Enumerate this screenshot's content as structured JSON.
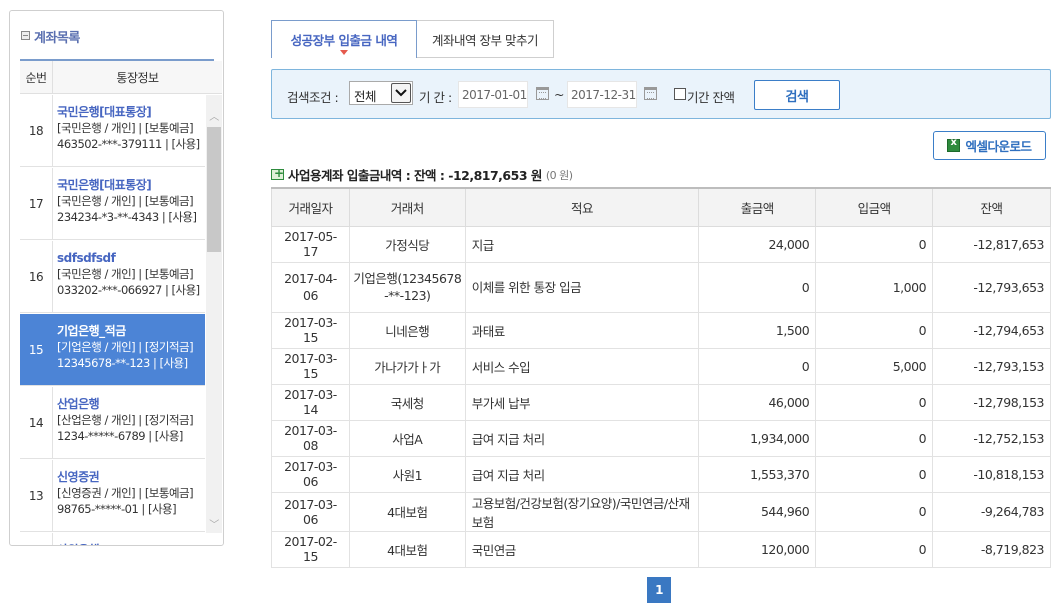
{
  "sidebar": {
    "title": "계좌목록",
    "col_no": "순번",
    "col_info": "통장정보",
    "accounts": [
      {
        "no": "18",
        "name": "국민은행[대표통장]",
        "line1": "[국민은행 / 개인] | [보통예금]",
        "line2": "463502-***-379111 | [사용]",
        "selected": false
      },
      {
        "no": "17",
        "name": "국민은행[대표통장]",
        "line1": "[국민은행 / 개인] | [보통예금]",
        "line2": "234234-*3-**-4343 | [사용]",
        "selected": false
      },
      {
        "no": "16",
        "name": "sdfsdfsdf",
        "line1": "[국민은행 / 개인] | [보통예금]",
        "line2": "033202-***-066927 | [사용]",
        "selected": false
      },
      {
        "no": "15",
        "name": "기업은행_적금",
        "line1": "[기업은행 / 개인] | [정기적금]",
        "line2": "12345678-**-123 | [사용]",
        "selected": true
      },
      {
        "no": "14",
        "name": "산업은행",
        "line1": "[산업은행 / 개인] | [정기적금]",
        "line2": "1234-*****-6789 | [사용]",
        "selected": false
      },
      {
        "no": "13",
        "name": "신영증권",
        "line1": "[신영증권 / 개인] | [보통예금]",
        "line2": "98765-*****-01 | [사용]",
        "selected": false
      },
      {
        "no": "",
        "name": "사원은행",
        "line1": "",
        "line2": "",
        "selected": false
      }
    ]
  },
  "tabs": [
    {
      "label": "성공장부 입출금 내역",
      "active": true
    },
    {
      "label": "계좌내역 장부 맞추기",
      "active": false
    }
  ],
  "search": {
    "cond_label": "검색조건 :",
    "cond_value": "전체",
    "period_label": "기 간 :",
    "start_date": "2017-01-01",
    "tilde": "~",
    "end_date": "2017-12-31",
    "balance_check_label": "기간 잔액",
    "search_button": "검색"
  },
  "excel_button": "엑셀다운로드",
  "summary": {
    "text": "사업용계좌 입출금내역 : 잔액 : -12,817,653 원",
    "sub": "(0 원)"
  },
  "table": {
    "headers": [
      "거래일자",
      "거래처",
      "적요",
      "출금액",
      "입금액",
      "잔액"
    ],
    "rows": [
      {
        "date": "2017-05-17",
        "party": "가정식당",
        "memo": "지급",
        "out": "24,000",
        "in": "0",
        "balance": "-12,817,653",
        "tall": false
      },
      {
        "date": "2017-04-06",
        "party": "기업은행(12345678-**-123)",
        "memo": "이체를 위한 통장 입금",
        "out": "0",
        "in": "1,000",
        "balance": "-12,793,653",
        "tall": true
      },
      {
        "date": "2017-03-15",
        "party": "니네은행",
        "memo": "과태료",
        "out": "1,500",
        "in": "0",
        "balance": "-12,794,653",
        "tall": false
      },
      {
        "date": "2017-03-15",
        "party": "가나가가ㅏ가",
        "memo": "서비스 수입",
        "out": "0",
        "in": "5,000",
        "balance": "-12,793,153",
        "tall": false
      },
      {
        "date": "2017-03-14",
        "party": "국세청",
        "memo": "부가세 납부",
        "out": "46,000",
        "in": "0",
        "balance": "-12,798,153",
        "tall": false
      },
      {
        "date": "2017-03-08",
        "party": "사업A",
        "memo": "급여 지급 처리",
        "out": "1,934,000",
        "in": "0",
        "balance": "-12,752,153",
        "tall": false
      },
      {
        "date": "2017-03-06",
        "party": "사원1",
        "memo": "급여 지급 처리",
        "out": "1,553,370",
        "in": "0",
        "balance": "-10,818,153",
        "tall": false
      },
      {
        "date": "2017-03-06",
        "party": "4대보험",
        "memo": "고용보험/건강보험(장기요양)/국민연금/산재보험",
        "out": "544,960",
        "in": "0",
        "balance": "-9,264,783",
        "tall": false
      },
      {
        "date": "2017-02-15",
        "party": "4대보험",
        "memo": "국민연금",
        "out": "120,000",
        "in": "0",
        "balance": "-8,719,823",
        "tall": false
      }
    ]
  },
  "pager": {
    "current": "1"
  }
}
